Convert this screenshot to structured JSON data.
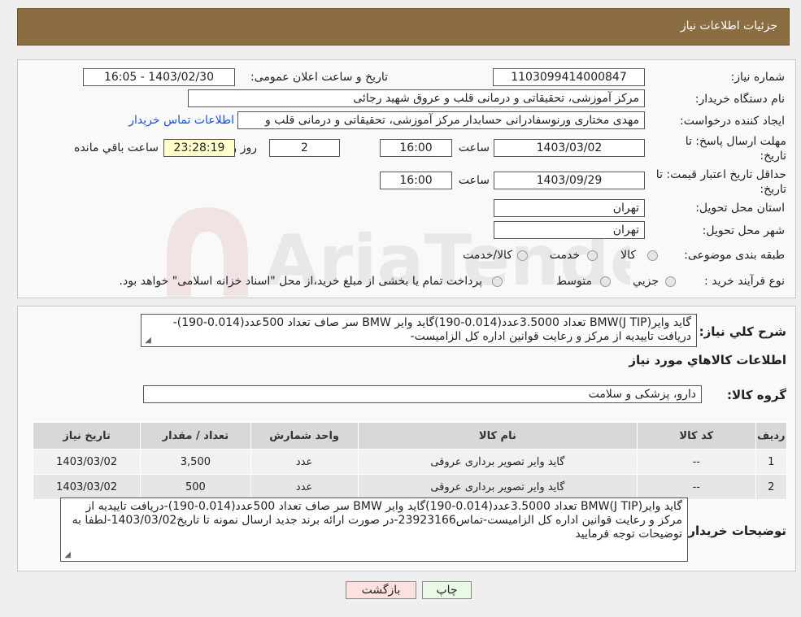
{
  "header": {
    "title": "جزئیات اطلاعات نیاز"
  },
  "form": {
    "need_number_label": "شماره نیاز:",
    "need_number": "1103099414000847",
    "announce_label": "تاریخ و ساعت اعلان عمومی:",
    "announce_value": "1403/02/30 - 16:05",
    "buyer_org_label": "نام دستگاه خریدار:",
    "buyer_org": "مرکز آموزشی، تحقیقاتی و درمانی قلب و عروق شهید رجائی",
    "creator_label": "ایجاد کننده درخواست:",
    "creator": "مهدی مختاری ورنوسفادرانی حسابدار مرکز آموزشی، تحقیقاتی و درمانی قلب و",
    "contact_link": "اطلاعات تماس خریدار",
    "deadline_label_line1": "مهلت ارسال پاسخ: تا",
    "deadline_label_line2": "تاریخ:",
    "deadline_date": "1403/03/02",
    "time_label": "ساعت",
    "deadline_time": "16:00",
    "days_count": "2",
    "days_label": "روز و",
    "remaining_time": "23:28:19",
    "remaining_label": "ساعت باقي مانده",
    "validity_label_line1": "حداقل تاریخ اعتبار قیمت: تا",
    "validity_label_line2": "تاریخ:",
    "validity_date": "1403/09/29",
    "validity_time": "16:00",
    "province_label": "استان محل تحویل:",
    "province": "تهران",
    "city_label": "شهر محل تحویل:",
    "city": "تهران",
    "category_label": "طبقه بندی موضوعی:",
    "category_options": [
      "کالا",
      "خدمت",
      "کالا/خدمت"
    ],
    "process_label": "نوع فرآیند خرید :",
    "process_options": [
      "جزیي",
      "متوسط"
    ],
    "process_note": "پرداخت تمام یا بخشی از مبلغ خرید،از محل \"اسناد خزانه اسلامی\" خواهد بود."
  },
  "summary": {
    "label": "شرح کلي نياز:",
    "text": "گاید وایرBMW(J TIP) تعداد 3.5000عدد(0.014-190)گاید وایر BMW سر صاف تعداد 500عدد(0.014-190)-دریافت تاییدیه از مرکز و رعایت قوانین اداره کل الزامیست-"
  },
  "goods": {
    "section_title": "اطلاعات کالاهاي مورد نياز",
    "group_label": "گروه کالا:",
    "group_value": "دارو، پزشکی و سلامت"
  },
  "table": {
    "headers": [
      "ردیف",
      "کد کالا",
      "نام کالا",
      "واحد شمارش",
      "تعداد / مقدار",
      "تاریخ نیاز"
    ],
    "rows": [
      [
        "1",
        "--",
        "گاید وایر تصویر برداری عروقی",
        "عدد",
        "3,500",
        "1403/03/02"
      ],
      [
        "2",
        "--",
        "گاید وایر تصویر برداری عروقی",
        "عدد",
        "500",
        "1403/03/02"
      ]
    ]
  },
  "buyer_notes": {
    "label": "توضیحات خریدار:",
    "text": "گاید وایرBMW(J TIP) تعداد 3.5000عدد(0.014-190)گاید وایر BMW سر صاف تعداد 500عدد(0.014-190)-دریافت تاییدیه از مرکز و رعایت قوانین اداره کل الزامیست-تماس23923166-در صورت ارائه برند جدید ارسال نمونه تا تاریخ1403/03/02-لطفا به توضیحات توجه فرمایید"
  },
  "buttons": {
    "print": "چاپ",
    "back": "بازگشت"
  },
  "watermark": {
    "text": "AriaTender.neT"
  },
  "colors": {
    "header_bg": "#8b6d42",
    "link": "#1a4fd8",
    "back_button_bg": "#fde0e0",
    "print_button_bg": "#eaf8e6"
  }
}
